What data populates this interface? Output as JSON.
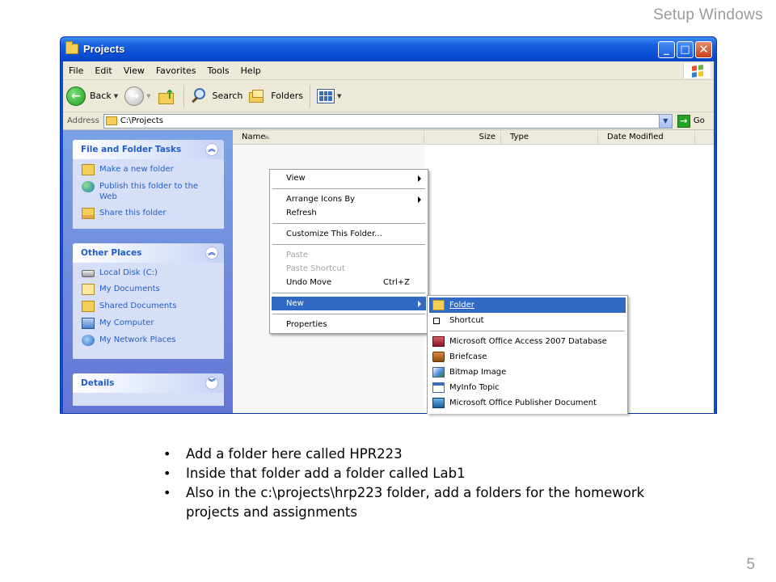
{
  "slide": {
    "title": "Setup Windows",
    "page_number": "5"
  },
  "window": {
    "title": "Projects",
    "buttons": {
      "minimize": "_",
      "maximize": "□",
      "close": "✕"
    }
  },
  "menubar": [
    "File",
    "Edit",
    "View",
    "Favorites",
    "Tools",
    "Help"
  ],
  "toolbar": {
    "back_label": "Back",
    "search_label": "Search",
    "folders_label": "Folders"
  },
  "addressbar": {
    "label": "Address",
    "value": "C:\\Projects",
    "go_label": "Go"
  },
  "tasks": {
    "file_folder": {
      "title": "File and Folder Tasks",
      "items": [
        "Make a new folder",
        "Publish this folder to the Web",
        "Share this folder"
      ]
    },
    "other_places": {
      "title": "Other Places",
      "items": [
        "Local Disk (C:)",
        "My Documents",
        "Shared Documents",
        "My Computer",
        "My Network Places"
      ]
    },
    "details": {
      "title": "Details"
    }
  },
  "columns": [
    "Name",
    "Size",
    "Type",
    "Date Modified"
  ],
  "context_menu": {
    "view": "View",
    "arrange": "Arrange Icons By",
    "refresh": "Refresh",
    "customize": "Customize This Folder...",
    "paste": "Paste",
    "paste_shortcut": "Paste Shortcut",
    "undo_move": "Undo Move",
    "undo_shortcut": "Ctrl+Z",
    "new": "New",
    "properties": "Properties"
  },
  "new_submenu": {
    "folder": "Folder",
    "shortcut": "Shortcut",
    "access": "Microsoft Office Access 2007 Database",
    "briefcase": "Briefcase",
    "bitmap": "Bitmap Image",
    "myinfo": "MyInfo Topic",
    "publisher": "Microsoft Office Publisher Document"
  },
  "bullets": [
    "Add a folder here called HPR223",
    "Inside that folder add a folder called Lab1",
    "Also in the c:\\projects\\hrp223 folder, add a folders for the homework projects and assignments"
  ]
}
